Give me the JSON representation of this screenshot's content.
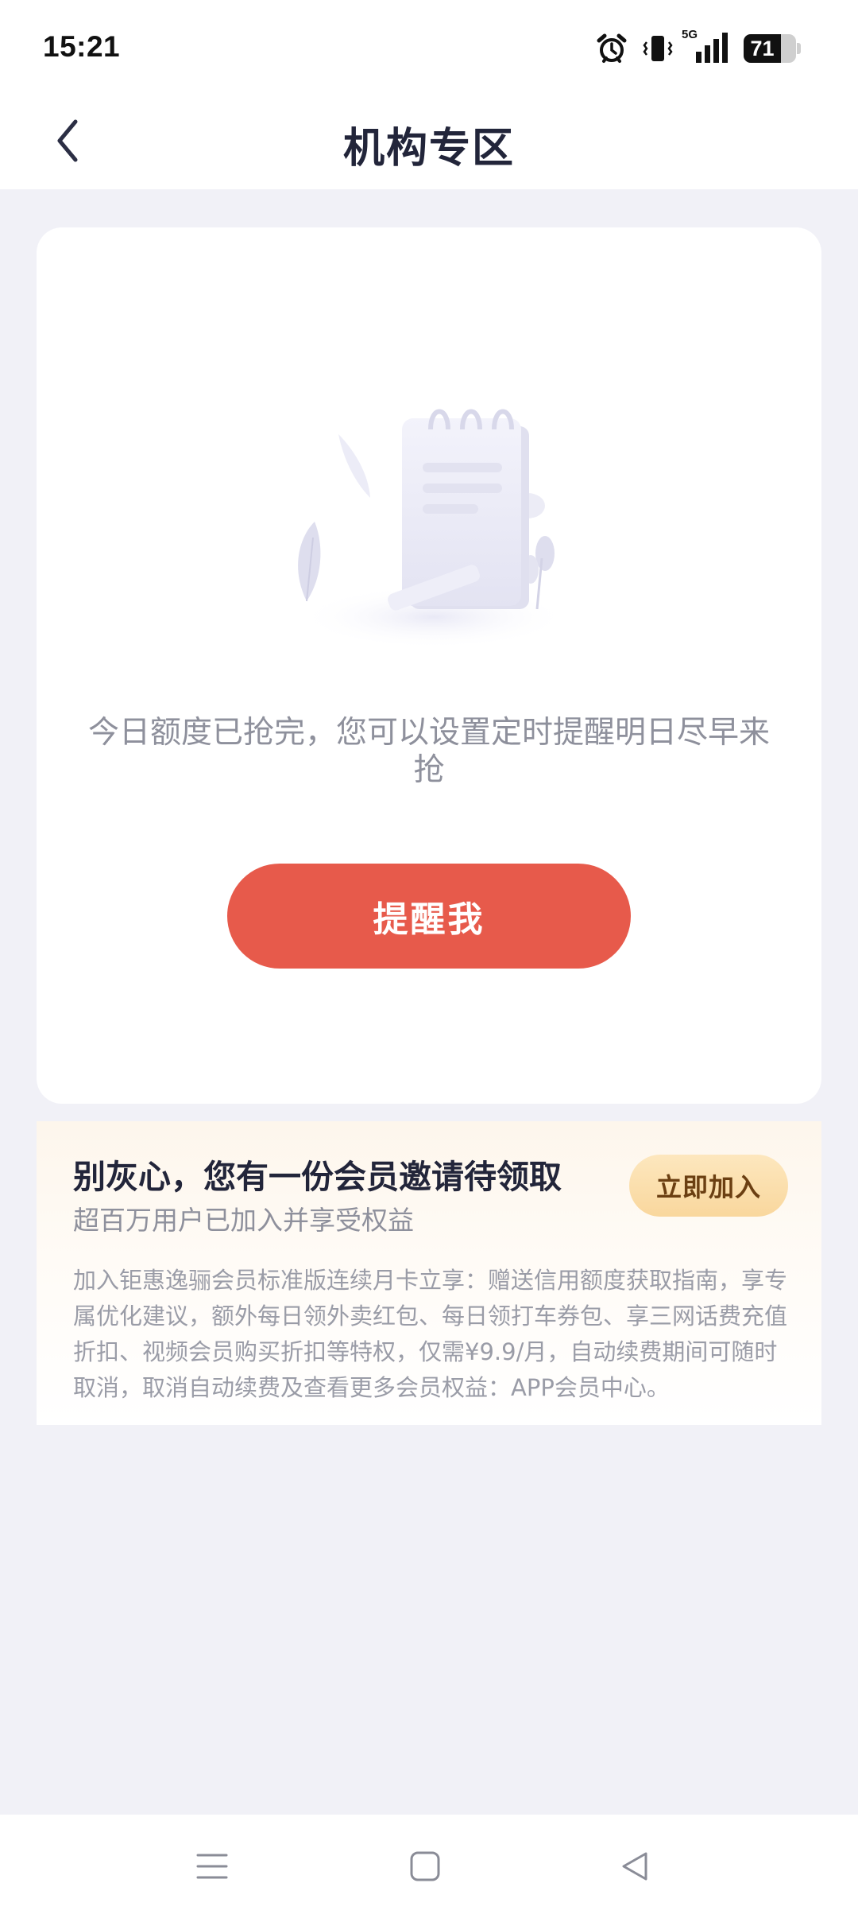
{
  "status_bar": {
    "time": "15:21",
    "network": "5G",
    "battery": "71",
    "battery_level": 0.71,
    "icons": [
      "alarm-icon",
      "vibrate-icon",
      "signal-icon",
      "battery-icon"
    ]
  },
  "header": {
    "title": "机构专区",
    "back_icon": "chevron-left-icon"
  },
  "empty_state": {
    "message": "今日额度已抢完，您可以设置定时提醒明日尽早来抢",
    "button_label": "提醒我",
    "illustration": "notepad-illustration",
    "button_color": "#e75a4b"
  },
  "membership": {
    "title": "别灰心，您有一份会员邀请待领取",
    "subtitle": "超百万用户已加入并享受权益",
    "join_label": "立即加入",
    "description": "加入钜惠逸骊会员标准版连续月卡立享：赠送信用额度获取指南，享专属优化建议，额外每日领外卖红包、每日领打车券包、享三网话费充值折扣、视频会员购买折扣等特权，仅需¥9.9/月，自动续费期间可随时取消，取消自动续费及查看更多会员权益：APP会员中心。"
  },
  "system_nav": {
    "buttons": [
      "menu-icon",
      "home-icon",
      "back-triangle-icon"
    ]
  }
}
